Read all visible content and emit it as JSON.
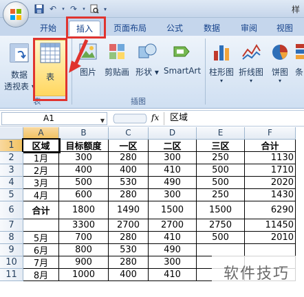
{
  "title_fragment": "样",
  "tabs": [
    {
      "label": "开始",
      "active": false
    },
    {
      "label": "插入",
      "active": true
    },
    {
      "label": "页面布局",
      "active": false
    },
    {
      "label": "公式",
      "active": false
    },
    {
      "label": "数据",
      "active": false
    },
    {
      "label": "审阅",
      "active": false
    },
    {
      "label": "视图",
      "active": false
    }
  ],
  "ribbon": {
    "pivot_label_1": "数据",
    "pivot_label_2": "透视表",
    "table_label": "表",
    "group_table_label": "表",
    "picture_label": "图片",
    "clipart_label": "剪贴画",
    "shapes_label": "形状",
    "smartart_label": "SmartArt",
    "group_illustrations_label": "插图",
    "column_chart_label": "柱形图",
    "line_chart_label": "折线图",
    "pie_chart_label": "饼图",
    "bar_chart_label": "条"
  },
  "formula_bar": {
    "name_box": "A1",
    "fx": "fx",
    "content": "区域"
  },
  "sheet": {
    "columns": [
      "A",
      "B",
      "C",
      "D",
      "E",
      "F"
    ],
    "row_numbers": [
      "1",
      "2",
      "3",
      "4",
      "5",
      "6",
      "7",
      "8",
      "9",
      "10",
      "11"
    ],
    "rows": [
      [
        "区域",
        "目标额度",
        "一区",
        "二区",
        "三区",
        "合计"
      ],
      [
        "1月",
        "300",
        "280",
        "300",
        "250",
        "1130"
      ],
      [
        "2月",
        "400",
        "400",
        "410",
        "500",
        "1710"
      ],
      [
        "3月",
        "500",
        "530",
        "490",
        "500",
        "2020"
      ],
      [
        "4月",
        "600",
        "280",
        "300",
        "250",
        "1430"
      ],
      [
        "合计",
        "1800",
        "1490",
        "1500",
        "1500",
        "6290"
      ],
      [
        "",
        "3300",
        "2700",
        "2700",
        "2750",
        "11450"
      ],
      [
        "5月",
        "700",
        "280",
        "410",
        "500",
        "2010"
      ],
      [
        "6月",
        "800",
        "530",
        "490",
        "",
        ""
      ],
      [
        "7月",
        "900",
        "280",
        "300",
        "",
        ""
      ],
      [
        "8月",
        "1000",
        "400",
        "410",
        "",
        ""
      ]
    ]
  },
  "watermark": "软件技巧"
}
